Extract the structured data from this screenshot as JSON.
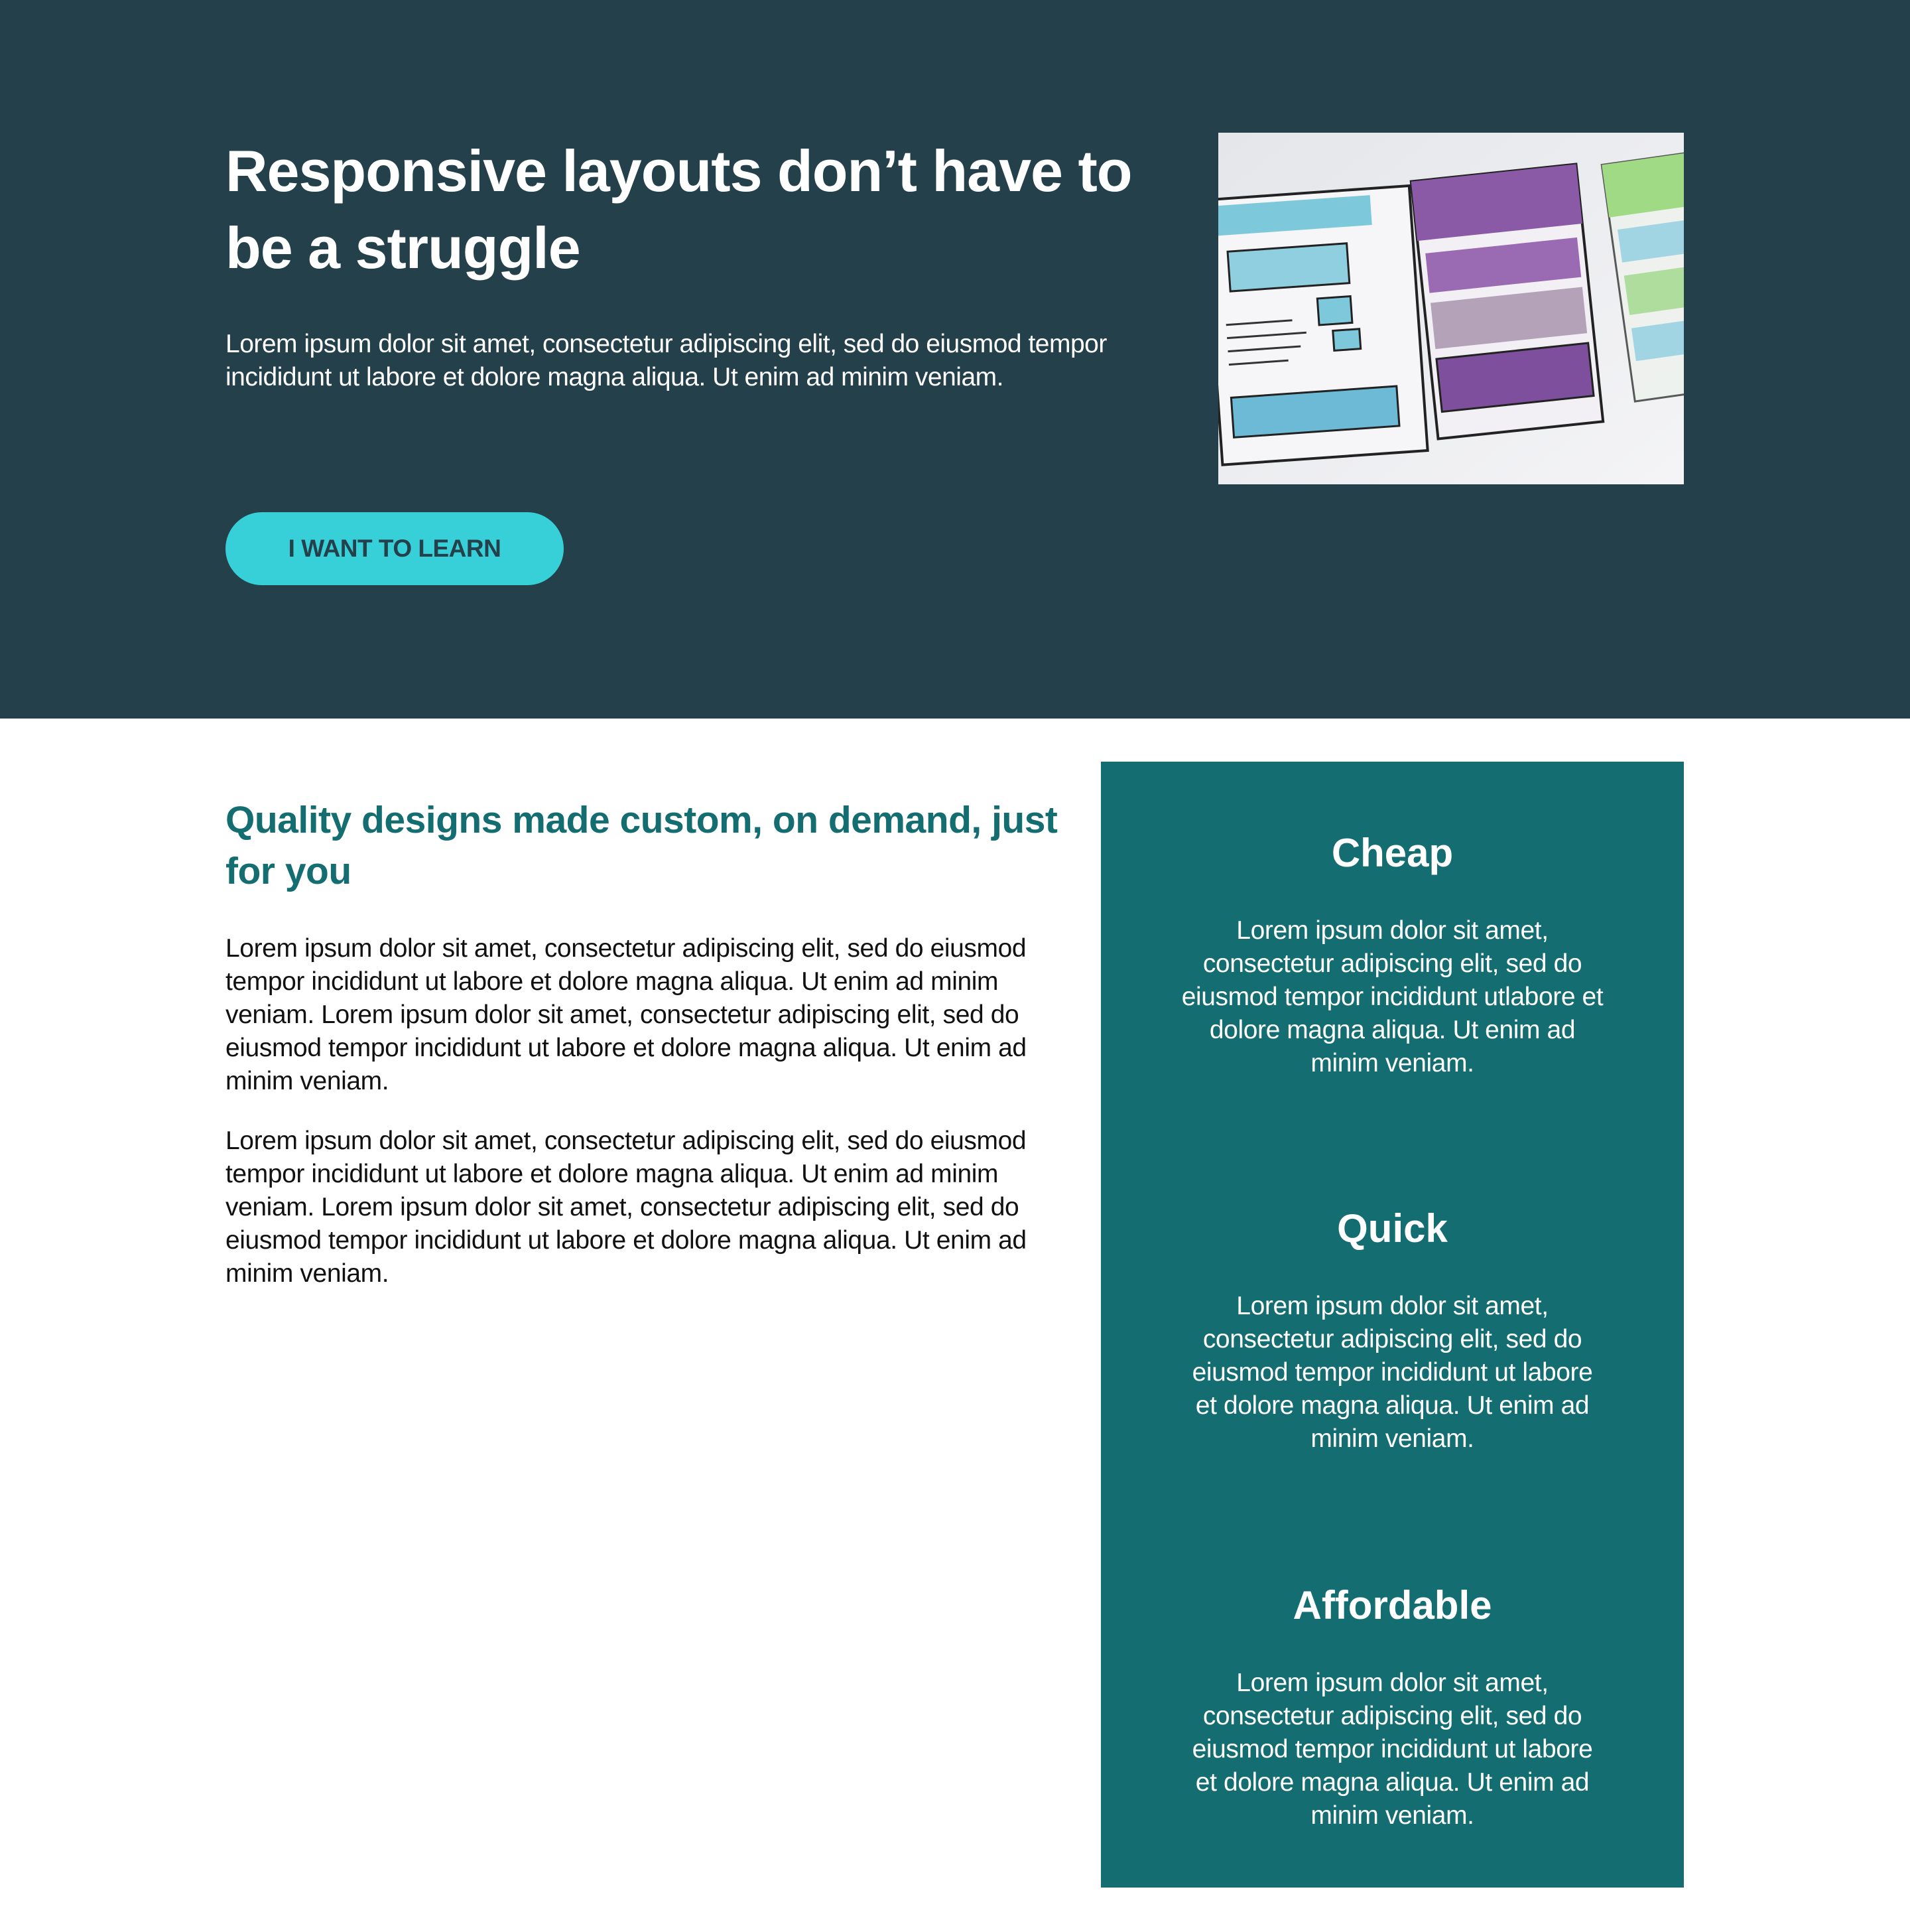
{
  "colors": {
    "hero_bg": "#24404a",
    "accent": "#37d0d9",
    "panel_bg": "#146d71",
    "heading_teal": "#146d71"
  },
  "hero": {
    "title": "Responsive layouts don’t have to be a struggle",
    "text": "Lorem ipsum dolor sit amet, consectetur adipiscing elit, sed do eiusmod tempor incididunt ut labore et dolore magna aliqua. Ut enim ad minim veniam.",
    "cta_label": "I WANT TO LEARN",
    "image_icon": "wireframe-sketch-photo"
  },
  "main": {
    "title": "Quality designs made custom, on demand, just for you",
    "paragraphs": [
      "Lorem ipsum dolor sit amet, consectetur adipiscing elit, sed do eiusmod tempor incididunt ut labore et dolore magna aliqua. Ut enim ad minim veniam. Lorem ipsum dolor sit amet, consectetur adipiscing elit, sed do eiusmod tempor incididunt ut labore et dolore magna aliqua. Ut enim ad minim veniam.",
      "Lorem ipsum dolor sit amet, consectetur adipiscing elit, sed do eiusmod tempor incididunt ut labore et dolore magna aliqua. Ut enim ad minim veniam. Lorem ipsum dolor sit amet, consectetur adipiscing elit, sed do eiusmod tempor incididunt ut labore et dolore magna aliqua. Ut enim ad minim veniam."
    ]
  },
  "features": [
    {
      "title": "Cheap",
      "text": "Lorem ipsum dolor sit amet, consectetur adipiscing elit, sed do eiusmod tempor incididunt utlabore et dolore magna aliqua. Ut enim ad minim veniam."
    },
    {
      "title": "Quick",
      "text": "Lorem ipsum dolor sit amet, consectetur adipiscing elit, sed do eiusmod tempor incididunt ut labore et dolore magna aliqua. Ut enim ad minim veniam."
    },
    {
      "title": "Affordable",
      "text": "Lorem ipsum dolor sit amet, consectetur adipiscing elit, sed do eiusmod tempor incididunt ut labore et dolore magna aliqua. Ut enim ad minim veniam."
    }
  ]
}
